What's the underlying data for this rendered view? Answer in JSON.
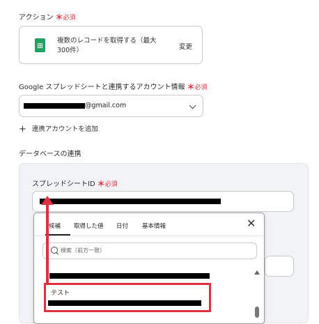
{
  "action": {
    "label": "アクション",
    "required_mark": "＊",
    "required_text": "必須",
    "action_text": "複数のレコードを取得する（最大300件）",
    "change_label": "変更"
  },
  "account": {
    "label": "Google スプレッドシートと連携するアカウント情報",
    "required_mark": "＊",
    "required_text": "必須",
    "email_suffix": "@gmail.com",
    "add_label": "連携アカウントを追加",
    "add_icon": "plus-icon"
  },
  "database": {
    "section_title": "データベースの連携",
    "sheet_id_label": "スプレッドシートID",
    "required_mark": "＊",
    "required_text": "必須"
  },
  "popup": {
    "tabs": [
      {
        "label": "候補"
      },
      {
        "label": "取得した値"
      },
      {
        "label": "日付"
      },
      {
        "label": "基本情報"
      }
    ],
    "search_placeholder": "検索（前方一致）",
    "option_test_label": "テスト",
    "close_icon": "close-icon"
  },
  "colors": {
    "required": "#e0303f",
    "annotation": "#e0303f",
    "sheets_icon": "#1ea362"
  }
}
